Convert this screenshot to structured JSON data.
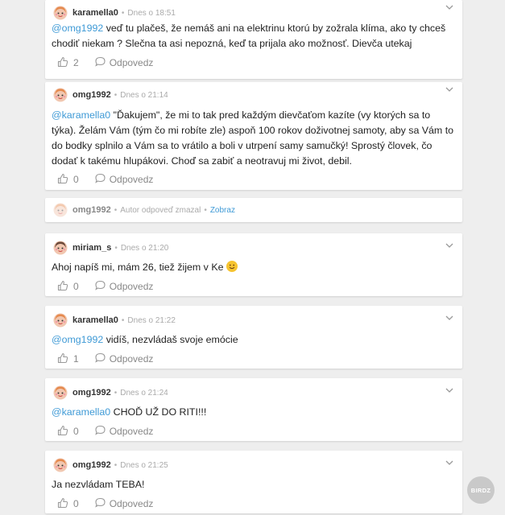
{
  "comments": [
    {
      "author": "karamella0",
      "time": "Dnes o 18:51",
      "mention": "@omg1992",
      "text": " veď tu plačeš, že nemáš ani na elektrinu ktorú by zožrala klíma, ako ty chceš chodiť niekam ? Slečna ta asi nepozná, keď ta prijala ako možnosť. Dievča utekaj",
      "likes": "2",
      "reply_label": "Odpovedz"
    },
    {
      "author": "omg1992",
      "time": "Dnes o 21:14",
      "mention": "@karamella0",
      "text": " \"Ďakujem\", že mi to tak pred každým dievčaťom kazíte (vy ktorých sa to týka). Želám Vám (tým čo mi robíte zle) aspoň 100 rokov doživotnej samoty, aby sa Vám to do bodky splnilo a Vám sa to vrátilo a boli v utrpení samy samučký! Sprostý človek, čo dodať k takému hlupákovi. Choď sa zabiť a neotravuj mi život, debil.",
      "likes": "0",
      "reply_label": "Odpovedz"
    },
    {
      "author": "omg1992",
      "deleted_note": "Autor odpoveď zmazal",
      "show_label": "Zobraz"
    },
    {
      "author": "miriam_s",
      "time": "Dnes o 21:20",
      "text": "Ahoj napíš mi, mám 26, tiež žijem v Ke",
      "likes": "0",
      "reply_label": "Odpovedz"
    },
    {
      "author": "karamella0",
      "time": "Dnes o 21:22",
      "mention": "@omg1992",
      "text": " vidíš, nezvládaš svoje emócie",
      "likes": "1",
      "reply_label": "Odpovedz"
    },
    {
      "author": "omg1992",
      "time": "Dnes o 21:24",
      "mention": "@karamella0",
      "text": " CHOĎ UŽ DO RITI!!!",
      "likes": "0",
      "reply_label": "Odpovedz"
    },
    {
      "author": "omg1992",
      "time": "Dnes o 21:25",
      "text": "Ja nezvládam TEBA!",
      "likes": "0",
      "reply_label": "Odpovedz"
    }
  ],
  "separator": "•",
  "watermark": "BIRDZ",
  "colors": {
    "background": "#eeeeee",
    "card": "#ffffff",
    "mention": "#3f9ad6",
    "muted": "#888888",
    "emoji": "#f6c431"
  },
  "icons": {
    "avatar": "girl-avatar-icon",
    "like": "thumbs-up-icon",
    "reply": "speech-bubble-icon",
    "menu": "chevron-down-icon",
    "emoji": "smiley-emoji-icon"
  }
}
